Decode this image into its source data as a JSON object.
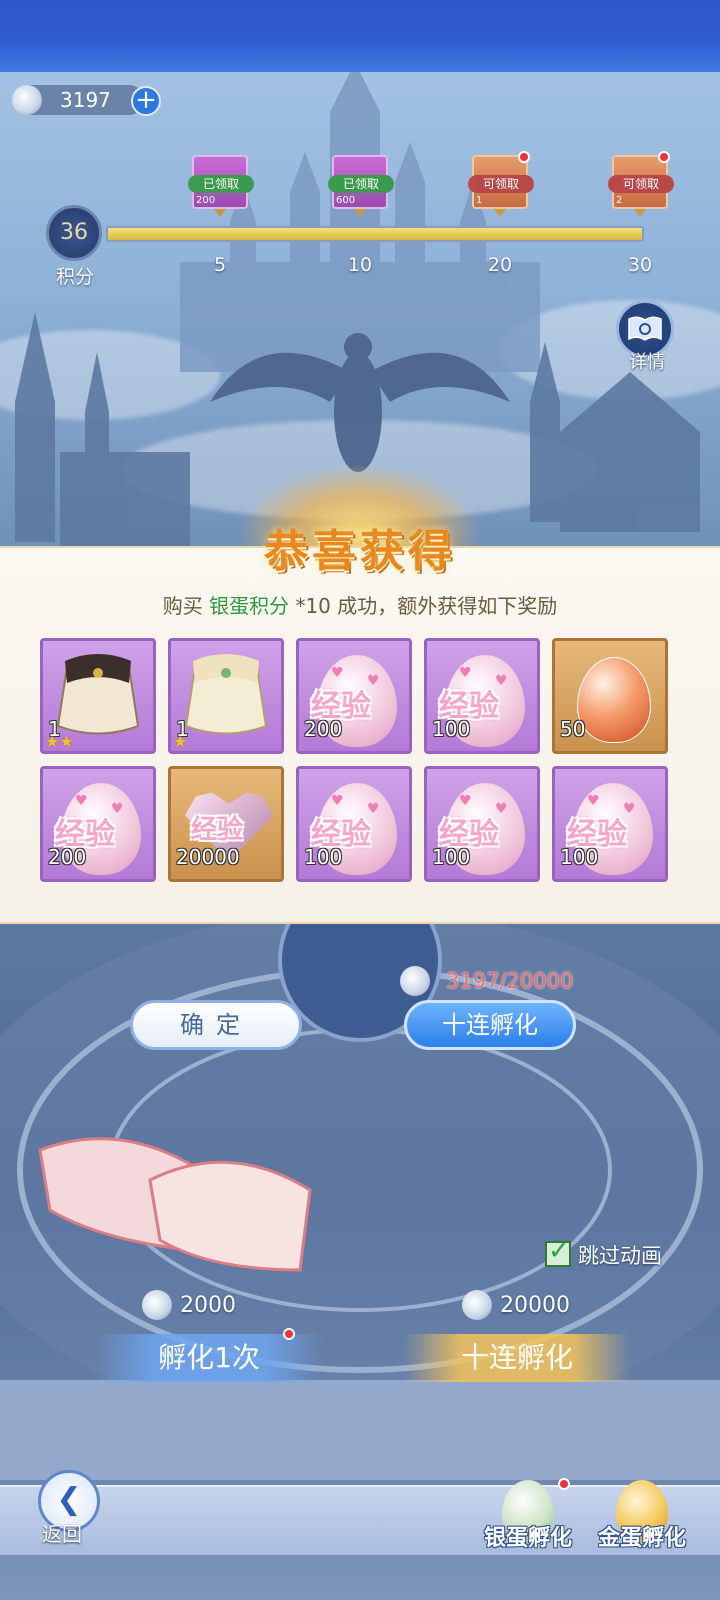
{
  "currency": {
    "amount": "3197",
    "icon": "silver-egg-coin-icon"
  },
  "progress": {
    "score": "36",
    "score_label": "积分",
    "fill_fraction": 1.0,
    "milestones": [
      {
        "points": "5",
        "status": "已领取",
        "count": "200"
      },
      {
        "points": "10",
        "status": "已领取",
        "count": "600"
      },
      {
        "points": "20",
        "status": "可领取",
        "count": "1"
      },
      {
        "points": "30",
        "status": "可领取",
        "count": "2"
      }
    ]
  },
  "detail": {
    "label": "详情"
  },
  "reward": {
    "title": "恭喜获得",
    "line_prefix": "购买",
    "line_highlight": "银蛋积分",
    "line_suffix": "*10 成功，额外获得如下奖励",
    "items": [
      {
        "kind": "outfit-dark",
        "qty": "1",
        "stars": "★★",
        "rarity": "purple"
      },
      {
        "kind": "outfit-light",
        "qty": "1",
        "stars": "★",
        "rarity": "purple"
      },
      {
        "kind": "exp-egg",
        "text": "经验",
        "qty": "200",
        "rarity": "purple"
      },
      {
        "kind": "exp-egg",
        "text": "经验",
        "qty": "100",
        "rarity": "purple"
      },
      {
        "kind": "crystal-egg",
        "qty": "50",
        "rarity": "gold"
      },
      {
        "kind": "exp-egg",
        "text": "经验",
        "qty": "200",
        "rarity": "purple"
      },
      {
        "kind": "exp-heart",
        "text": "经验",
        "qty": "20000",
        "rarity": "gold"
      },
      {
        "kind": "exp-egg",
        "text": "经验",
        "qty": "100",
        "rarity": "purple"
      },
      {
        "kind": "exp-egg",
        "text": "经验",
        "qty": "100",
        "rarity": "purple"
      },
      {
        "kind": "exp-egg",
        "text": "经验",
        "qty": "100",
        "rarity": "purple"
      }
    ]
  },
  "actions": {
    "confirm_label": "确定",
    "ten_hatch_label": "十连孵化",
    "cost_progress": "3197/20000"
  },
  "hatch": {
    "skip_label": "跳过动画",
    "single_cost": "2000",
    "single_label": "孵化1次",
    "ten_cost": "20000",
    "ten_label": "十连孵化"
  },
  "bottom": {
    "back_label": "返回",
    "silver_tab": "银蛋孵化",
    "gold_tab": "金蛋孵化"
  },
  "colors": {
    "accent_blue": "#2c7fe8",
    "title_orange": "#e8891f",
    "highlight_green": "#2e9a3f",
    "cost_red": "#f16b6b"
  }
}
